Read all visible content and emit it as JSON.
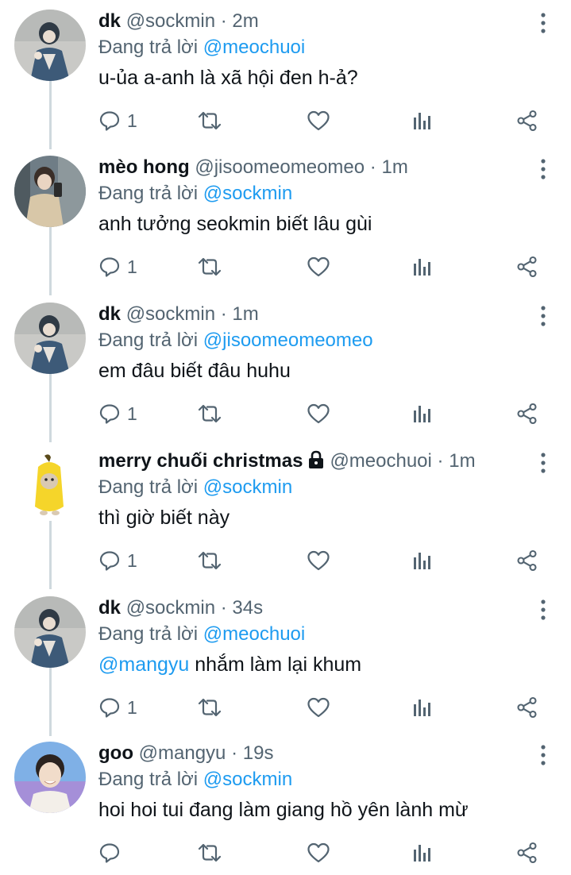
{
  "replying_label": "Đang trả lời",
  "colors": {
    "accent": "#1d9bf0",
    "secondary": "#536471",
    "text": "#0f1419",
    "thread_line": "#cfd9de"
  },
  "tweets": [
    {
      "name": "dk",
      "handle": "@sockmin",
      "time": "2m",
      "reply_to": "@meochuoi",
      "text_mention": "",
      "text": "u-ủa a-anh là xã hội đen h-ả?",
      "reply_count": "1",
      "avatar": "dk-avatar",
      "locked": false
    },
    {
      "name": "mèo hong",
      "handle": "@jisoomeomeomeo",
      "time": "1m",
      "reply_to": "@sockmin",
      "text_mention": "",
      "text": "anh tưởng seokmin biết lâu gùi",
      "reply_count": "1",
      "avatar": "meohong-avatar",
      "locked": false
    },
    {
      "name": "dk",
      "handle": "@sockmin",
      "time": "1m",
      "reply_to": "@jisoomeomeomeo",
      "text_mention": "",
      "text": "em đâu biết đâu huhu",
      "reply_count": "1",
      "avatar": "dk-avatar",
      "locked": false
    },
    {
      "name": "merry chuối christmas",
      "handle": "@meochuoi",
      "time": "1m",
      "reply_to": "@sockmin",
      "text_mention": "",
      "text": "thì giờ biết này",
      "reply_count": "1",
      "avatar": "banana-cat-avatar",
      "locked": true
    },
    {
      "name": "dk",
      "handle": "@sockmin",
      "time": "34s",
      "reply_to": "@meochuoi",
      "text_mention": "@mangyu",
      "text": " nhắm làm lại khum",
      "reply_count": "1",
      "avatar": "dk-avatar",
      "locked": false
    },
    {
      "name": "goo",
      "handle": "@mangyu",
      "time": "19s",
      "reply_to": "@sockmin",
      "text_mention": "",
      "text": "hoi hoi tui đang làm giang hồ yên lành mừ",
      "reply_count": "",
      "avatar": "goo-avatar",
      "locked": false
    }
  ],
  "icons": {
    "reply": "reply-icon",
    "retweet": "retweet-icon",
    "like": "like-icon",
    "analytics": "analytics-icon",
    "share": "share-icon",
    "more": "more-icon",
    "lock": "lock-icon"
  }
}
